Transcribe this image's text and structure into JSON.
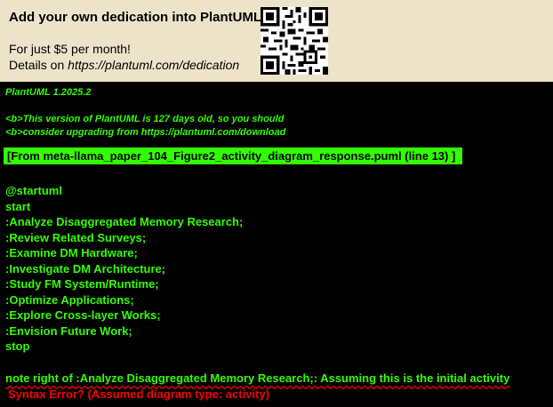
{
  "banner": {
    "title": "Add your own dedication into PlantUML",
    "line1": "For just $5 per month!",
    "line2_prefix": "Details on ",
    "line2_url": "https://plantuml.com/dedication",
    "qr_icon": "qr-code-icon",
    "background": "#ede3c9"
  },
  "console": {
    "version": "PlantUML 1.2025.2",
    "warning_line1": "<b>This version of PlantUML is 127 days old, so you should",
    "warning_line2": "<b>consider upgrading from https://plantuml.com/download",
    "file_label": "[From meta-llama_paper_104_Figure2_activity_diagram_response.puml (line 13) ]",
    "source_lines": [
      "@startuml",
      "start",
      ":Analyze Disaggregated Memory Research;",
      ":Review Related Surveys;",
      ":Examine DM Hardware;",
      ":Investigate DM Architecture;",
      ":Study FM System/Runtime;",
      ":Optimize Applications;",
      ":Explore Cross-layer Works;",
      ":Envision Future Work;",
      "stop"
    ],
    "error_source_line": "note right of :Analyze Disaggregated Memory Research;: Assuming this is the initial activity",
    "error_message": "Syntax Error? (Assumed diagram type: activity)",
    "text_color": "#33ff02",
    "error_color": "#ff0000"
  }
}
